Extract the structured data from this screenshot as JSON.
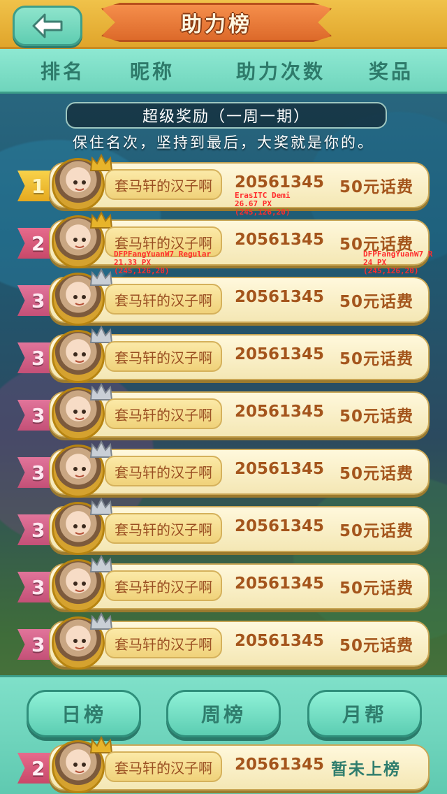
{
  "header": {
    "title": "助力榜"
  },
  "columns": [
    "排名",
    "昵称",
    "助力次数",
    "奖品"
  ],
  "reward": {
    "title": "超级奖励（一周一期）",
    "description": "保住名次，坚持到最后，大奖就是你的。"
  },
  "rows": [
    {
      "rank": "1",
      "name": "套马轩的汉子啊",
      "count": "20561345",
      "prize": "50元话费"
    },
    {
      "rank": "2",
      "name": "套马轩的汉子啊",
      "count": "20561345",
      "prize": "50元话费"
    },
    {
      "rank": "3",
      "name": "套马轩的汉子啊",
      "count": "20561345",
      "prize": "50元话费"
    },
    {
      "rank": "3",
      "name": "套马轩的汉子啊",
      "count": "20561345",
      "prize": "50元话费"
    },
    {
      "rank": "3",
      "name": "套马轩的汉子啊",
      "count": "20561345",
      "prize": "50元话费"
    },
    {
      "rank": "3",
      "name": "套马轩的汉子啊",
      "count": "20561345",
      "prize": "50元话费"
    },
    {
      "rank": "3",
      "name": "套马轩的汉子啊",
      "count": "20561345",
      "prize": "50元话费"
    },
    {
      "rank": "3",
      "name": "套马轩的汉子啊",
      "count": "20561345",
      "prize": "50元话费"
    },
    {
      "rank": "3",
      "name": "套马轩的汉子啊",
      "count": "20561345",
      "prize": "50元话费"
    }
  ],
  "specs": {
    "s1": [
      "ErasITC Demi",
      "26.67 PX",
      "(245,126,20)"
    ],
    "s2": [
      "DFPFangYuanW7 Regular",
      "21.33 PX",
      "(245,126,20)"
    ],
    "s3": [
      "DFPFangYuanW7 R",
      "24 PX",
      "(245,126,20)"
    ]
  },
  "tabs": [
    "日榜",
    "周榜",
    "月帮"
  ],
  "self": {
    "rank": "2",
    "name": "套马轩的汉子啊",
    "count": "20561345",
    "status": "暂未上榜"
  },
  "icons": {
    "back": "back-arrow-icon",
    "crown": "crown-icon",
    "avatar": "avatar-icon"
  }
}
